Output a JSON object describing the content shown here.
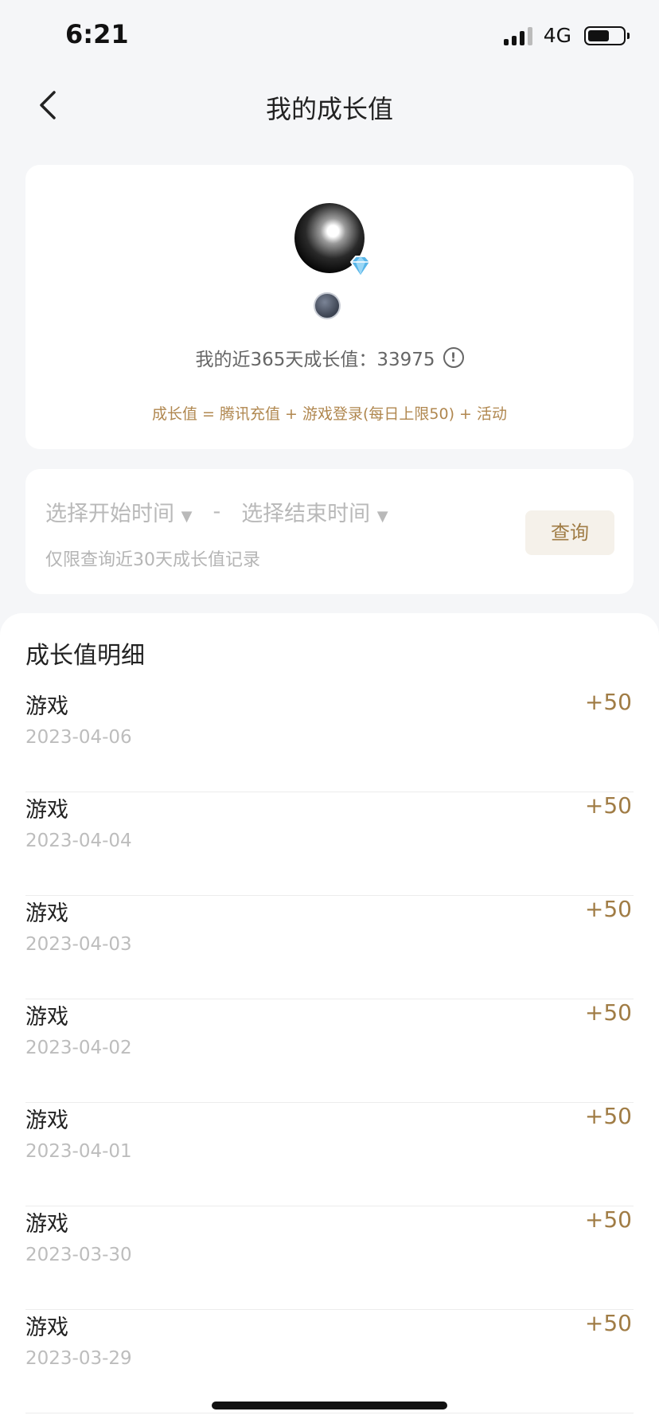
{
  "status": {
    "time": "6:21",
    "network": "4G"
  },
  "nav": {
    "title": "我的成长值"
  },
  "profile": {
    "growth_label": "我的近365天成长值：33975",
    "info_glyph": "!",
    "formula": "成长值 = 腾讯充值 + 游戏登录(每日上限50) + 活动"
  },
  "query": {
    "start_placeholder": "选择开始时间",
    "caret": "▼",
    "separator": "-",
    "end_placeholder": "选择结束时间",
    "hint": "仅限查询近30天成长值记录",
    "button_label": "查询"
  },
  "details": {
    "title": "成长值明细",
    "items": [
      {
        "name": "游戏",
        "date": "2023-04-06",
        "value": "+50"
      },
      {
        "name": "游戏",
        "date": "2023-04-04",
        "value": "+50"
      },
      {
        "name": "游戏",
        "date": "2023-04-03",
        "value": "+50"
      },
      {
        "name": "游戏",
        "date": "2023-04-02",
        "value": "+50"
      },
      {
        "name": "游戏",
        "date": "2023-04-01",
        "value": "+50"
      },
      {
        "name": "游戏",
        "date": "2023-03-30",
        "value": "+50"
      },
      {
        "name": "游戏",
        "date": "2023-03-29",
        "value": "+50"
      }
    ]
  },
  "colors": {
    "accent": "#a07c45",
    "formula": "#b0874f",
    "background": "#f5f6f8"
  },
  "icons": [
    "back-arrow-icon",
    "signal-icon",
    "battery-icon",
    "diamond-icon",
    "level-icon",
    "info-icon"
  ]
}
